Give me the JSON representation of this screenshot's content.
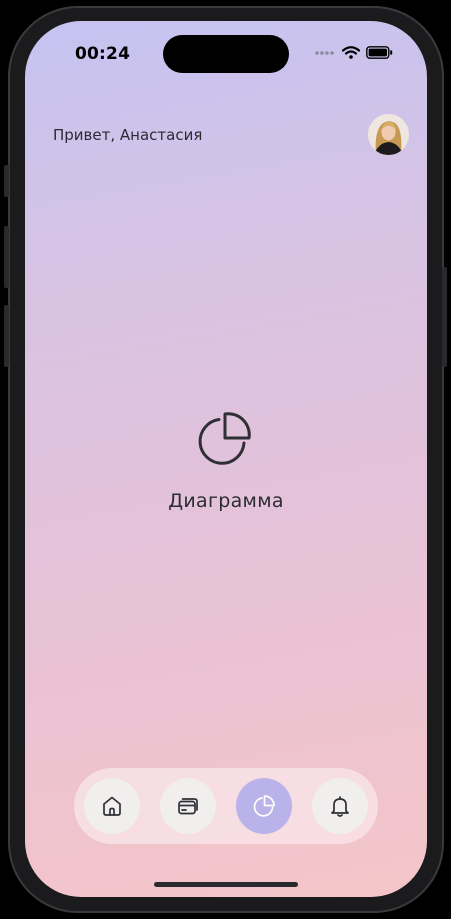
{
  "status_bar": {
    "time": "00:24"
  },
  "header": {
    "greeting": "Привет, Анастасия"
  },
  "main": {
    "label": "Диаграмма",
    "icon": "pie-chart-icon"
  },
  "tabbar": {
    "items": [
      {
        "icon": "home-icon",
        "active": false
      },
      {
        "icon": "cards-icon",
        "active": false
      },
      {
        "icon": "pie-chart-icon",
        "active": true
      },
      {
        "icon": "bell-icon",
        "active": false
      }
    ]
  },
  "colors": {
    "gradient_top": "#c5c3f1",
    "gradient_bottom": "#f5c5c8",
    "active_tab": "#bab3ea",
    "tab_bg": "#f1eeee"
  }
}
